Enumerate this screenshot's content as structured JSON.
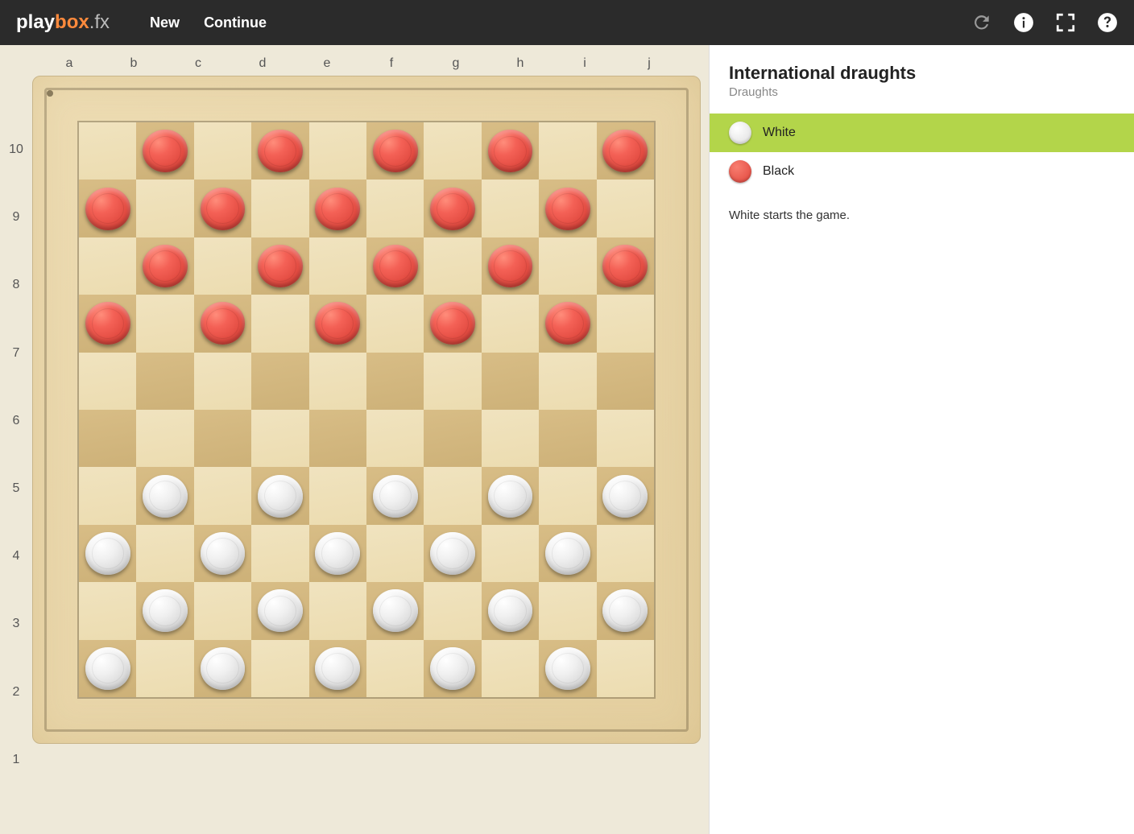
{
  "brand": {
    "p1": "play",
    "p2": "box",
    "p3": ".fx"
  },
  "nav": {
    "new_label": "New",
    "continue_label": "Continue"
  },
  "sidebar": {
    "title": "International draughts",
    "subtitle": "Draughts",
    "white_label": "White",
    "black_label": "Black",
    "status": "White starts the game."
  },
  "board": {
    "cols": [
      "a",
      "b",
      "c",
      "d",
      "e",
      "f",
      "g",
      "h",
      "i",
      "j"
    ],
    "rows": [
      "10",
      "9",
      "8",
      "7",
      "6",
      "5",
      "4",
      "3",
      "2",
      "1"
    ],
    "size": 10,
    "pieces": [
      {
        "row": 0,
        "col": 1,
        "color": "red"
      },
      {
        "row": 0,
        "col": 3,
        "color": "red"
      },
      {
        "row": 0,
        "col": 5,
        "color": "red"
      },
      {
        "row": 0,
        "col": 7,
        "color": "red"
      },
      {
        "row": 0,
        "col": 9,
        "color": "red"
      },
      {
        "row": 1,
        "col": 0,
        "color": "red"
      },
      {
        "row": 1,
        "col": 2,
        "color": "red"
      },
      {
        "row": 1,
        "col": 4,
        "color": "red"
      },
      {
        "row": 1,
        "col": 6,
        "color": "red"
      },
      {
        "row": 1,
        "col": 8,
        "color": "red"
      },
      {
        "row": 2,
        "col": 1,
        "color": "red"
      },
      {
        "row": 2,
        "col": 3,
        "color": "red"
      },
      {
        "row": 2,
        "col": 5,
        "color": "red"
      },
      {
        "row": 2,
        "col": 7,
        "color": "red"
      },
      {
        "row": 2,
        "col": 9,
        "color": "red"
      },
      {
        "row": 3,
        "col": 0,
        "color": "red"
      },
      {
        "row": 3,
        "col": 2,
        "color": "red"
      },
      {
        "row": 3,
        "col": 4,
        "color": "red"
      },
      {
        "row": 3,
        "col": 6,
        "color": "red"
      },
      {
        "row": 3,
        "col": 8,
        "color": "red"
      },
      {
        "row": 6,
        "col": 1,
        "color": "white"
      },
      {
        "row": 6,
        "col": 3,
        "color": "white"
      },
      {
        "row": 6,
        "col": 5,
        "color": "white"
      },
      {
        "row": 6,
        "col": 7,
        "color": "white"
      },
      {
        "row": 6,
        "col": 9,
        "color": "white"
      },
      {
        "row": 7,
        "col": 0,
        "color": "white"
      },
      {
        "row": 7,
        "col": 2,
        "color": "white"
      },
      {
        "row": 7,
        "col": 4,
        "color": "white"
      },
      {
        "row": 7,
        "col": 6,
        "color": "white"
      },
      {
        "row": 7,
        "col": 8,
        "color": "white"
      },
      {
        "row": 8,
        "col": 1,
        "color": "white"
      },
      {
        "row": 8,
        "col": 3,
        "color": "white"
      },
      {
        "row": 8,
        "col": 5,
        "color": "white"
      },
      {
        "row": 8,
        "col": 7,
        "color": "white"
      },
      {
        "row": 8,
        "col": 9,
        "color": "white"
      },
      {
        "row": 9,
        "col": 0,
        "color": "white"
      },
      {
        "row": 9,
        "col": 2,
        "color": "white"
      },
      {
        "row": 9,
        "col": 4,
        "color": "white"
      },
      {
        "row": 9,
        "col": 6,
        "color": "white"
      },
      {
        "row": 9,
        "col": 8,
        "color": "white"
      }
    ]
  },
  "active_player": "white"
}
